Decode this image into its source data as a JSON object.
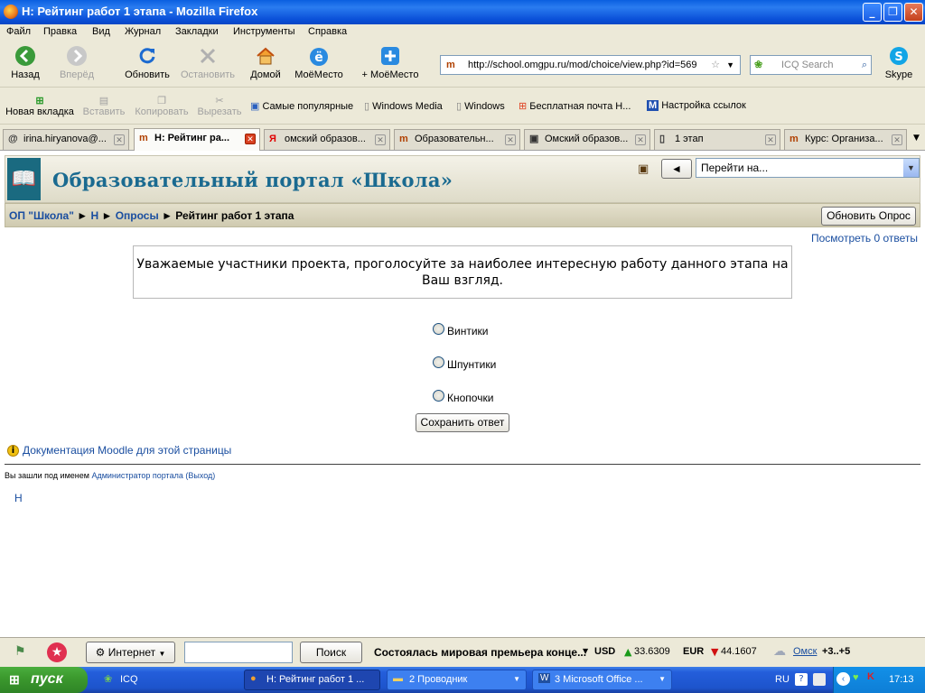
{
  "window": {
    "title": "Н: Рейтинг работ 1 этапа - Mozilla Firefox"
  },
  "menu": [
    "Файл",
    "Правка",
    "Вид",
    "Журнал",
    "Закладки",
    "Инструменты",
    "Справка"
  ],
  "nav": {
    "back": "Назад",
    "forward": "Вперёд",
    "reload": "Обновить",
    "stop": "Остановить",
    "home": "Домой",
    "moemesto": "МоёМесто",
    "add_moemesto": "+ МоёМесто",
    "skype": "Skype"
  },
  "url": "http://school.omgpu.ru/mod/choice/view.php?id=569",
  "search_placeholder": "ICQ Search",
  "bookmarks": {
    "new_tab": "Новая вкладка",
    "paste": "Вставить",
    "copy": "Копировать",
    "cut": "Вырезать",
    "items": [
      "Самые популярные",
      "Windows Media",
      "Windows",
      "Бесплатная почта Н...",
      "Настройка ссылок"
    ]
  },
  "tabs": [
    "irina.hiryanova@...",
    "Н: Рейтинг ра...",
    "омский образов...",
    "Образовательн...",
    "Омский образов...",
    "1 этап",
    "Курс: Организа..."
  ],
  "page": {
    "site_name": "Образовательный портал «Школа»",
    "jump_label": "Перейти на...",
    "crumbs": [
      "ОП \"Школа\"",
      "Н",
      "Опросы",
      "Рейтинг работ 1 этапа"
    ],
    "update_button": "Обновить Опрос",
    "view_answers": "Посмотреть 0 ответы",
    "message": "Уважаемые участники проекта, проголосуйте за наиболее интересную работу данного этапа на Ваш взгляд.",
    "options": [
      "Винтики",
      "Шпунтики",
      "Кнопочки"
    ],
    "save_button": "Сохранить ответ",
    "doc_link": "Документация Moodle для этой страницы",
    "logged_prefix": "Вы зашли под именем",
    "logged_user": "Администратор портала",
    "logout": "(Выход)",
    "footer_link": "Н"
  },
  "status": {
    "internet": "Интернет",
    "search_btn": "Поиск",
    "news": "Состоялась мировая премьера конце...",
    "usd_label": "USD",
    "usd": "33.6309",
    "eur_label": "EUR",
    "eur": "44.1607",
    "city": "Омск",
    "temp": "+3..+5"
  },
  "taskbar": {
    "start": "пуск",
    "items": [
      "ICQ",
      "Н: Рейтинг работ 1 ...",
      "2 Проводник",
      "3 Microsoft Office ..."
    ],
    "lang": "RU",
    "time": "17:13"
  },
  "colors": {
    "accent": "#1a6a90",
    "link": "#1a4ea0"
  }
}
